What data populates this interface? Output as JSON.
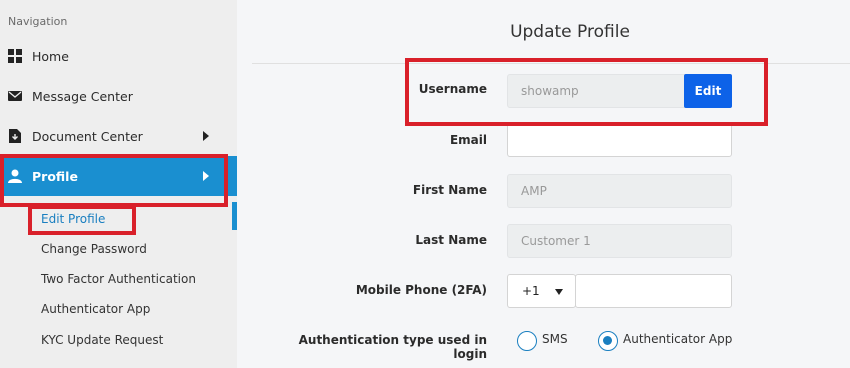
{
  "sidebar": {
    "heading": "Navigation",
    "items": [
      {
        "label": "Home",
        "icon": "grid-icon"
      },
      {
        "label": "Message Center",
        "icon": "envelope-icon"
      },
      {
        "label": "Document Center",
        "icon": "document-download-icon"
      },
      {
        "label": "Profile",
        "icon": "user-icon"
      }
    ],
    "profile_submenu": [
      {
        "label": "Edit Profile"
      },
      {
        "label": "Change Password"
      },
      {
        "label": "Two Factor Authentication"
      },
      {
        "label": "Authenticator App"
      },
      {
        "label": "KYC Update Request"
      }
    ]
  },
  "main": {
    "title": "Update Profile",
    "fields": {
      "username": {
        "label": "Username",
        "value": "showamp",
        "button": "Edit"
      },
      "email": {
        "label": "Email",
        "value": ""
      },
      "first_name": {
        "label": "First Name",
        "placeholder": "AMP"
      },
      "last_name": {
        "label": "Last Name",
        "placeholder": "Customer 1"
      },
      "mobile": {
        "label": "Mobile Phone (2FA)",
        "country_code": "+1",
        "value": ""
      },
      "auth_type": {
        "label": "Authentication type used in login",
        "options": [
          "SMS",
          "Authenticator App"
        ],
        "selected": "Authenticator App"
      }
    }
  },
  "colors": {
    "accent": "#1a8fd0",
    "highlight": "#d9202a",
    "edit_button": "#0d62e8"
  }
}
